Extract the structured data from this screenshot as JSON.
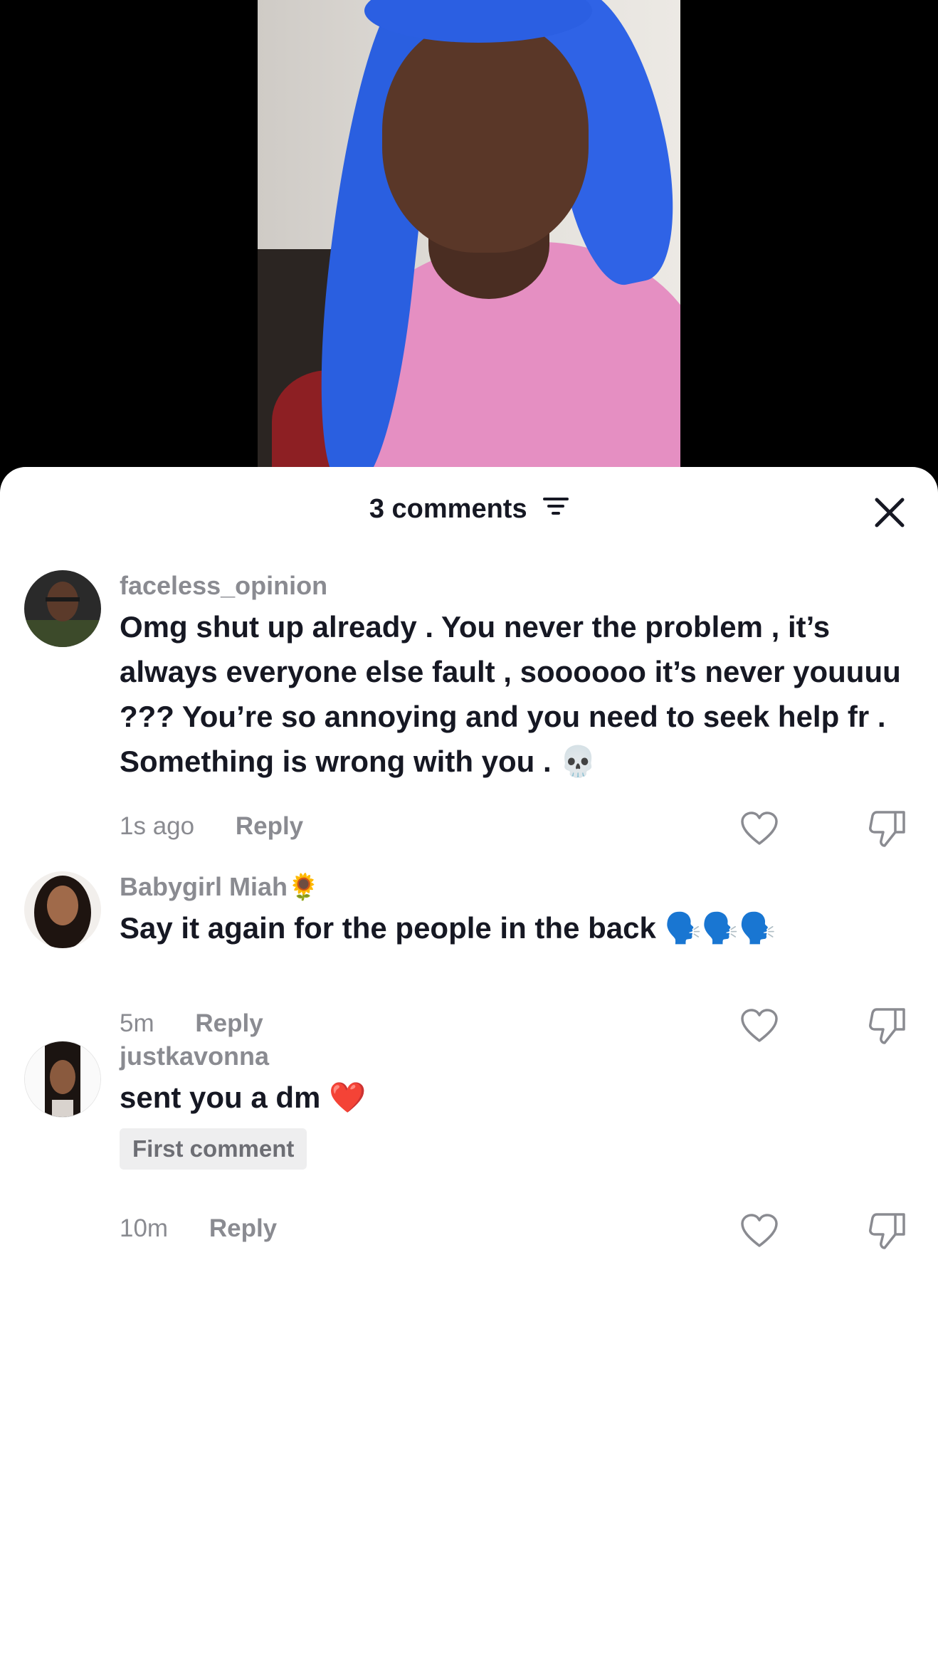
{
  "video": {
    "description_hidden": true
  },
  "comments_panel": {
    "count_label": "3 comments",
    "comments": [
      {
        "username": "faceless_opinion",
        "text": "Omg shut up already . You never the problem , it’s always everyone else fault , soooooo it’s never youuuu ??? You’re so annoying and you need to seek help fr . Something is wrong with you . 💀",
        "time": "1s ago",
        "reply_label": "Reply"
      },
      {
        "username": "Babygirl Miah🌻",
        "text": "Say it again for the people in the back 🗣️🗣️🗣️",
        "time": "5m",
        "reply_label": "Reply"
      },
      {
        "username": "justkavonna",
        "text": "sent you a dm ❤️",
        "badge": "First comment",
        "time": "10m",
        "reply_label": "Reply"
      }
    ]
  },
  "icons": {
    "filter": "filter-icon",
    "close": "close-icon",
    "like": "heart-outline-icon",
    "dislike": "thumbs-down-icon"
  }
}
